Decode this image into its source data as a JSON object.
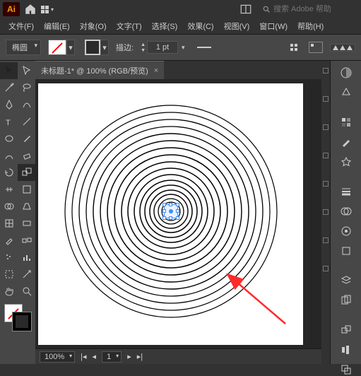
{
  "app": {
    "logo": "Ai"
  },
  "search": {
    "placeholder": "搜索 Adobe 帮助"
  },
  "menu": [
    "文件(F)",
    "编辑(E)",
    "对象(O)",
    "文字(T)",
    "选择(S)",
    "效果(C)",
    "视图(V)",
    "窗口(W)",
    "帮助(H)"
  ],
  "control": {
    "shape": "椭圆",
    "stroke_label": "描边:",
    "stroke_pt": "1 pt"
  },
  "document": {
    "tab_title": "未标题-1* @ 100% (RGB/预览)"
  },
  "status": {
    "zoom": "100%",
    "artboard_nav": "1"
  },
  "tools": [
    "selection",
    "direct-selection",
    "magic-wand",
    "lasso",
    "pen",
    "curvature",
    "type",
    "line",
    "ellipse",
    "paintbrush",
    "shaper",
    "eraser",
    "rotate",
    "scale",
    "width",
    "free-transform",
    "shape-builder",
    "perspective",
    "mesh",
    "gradient",
    "eyedropper",
    "blend",
    "symbol-sprayer",
    "column-graph",
    "artboard",
    "slice",
    "hand",
    "zoom"
  ],
  "right_panel_icons": [
    "color",
    "color-guide",
    "swatches",
    "brushes",
    "symbols",
    "stroke",
    "transparency",
    "appearance",
    "graphic-styles",
    "layers",
    "artboards",
    "transform",
    "align",
    "pathfinder",
    "actions"
  ]
}
